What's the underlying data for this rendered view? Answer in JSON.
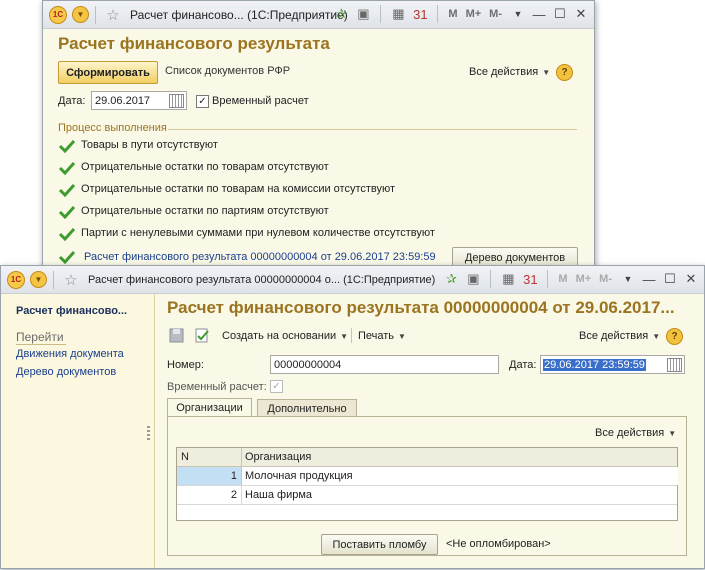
{
  "back_window": {
    "title": "Расчет финансово...  (1С:Предприятие)",
    "toolbar_m": [
      "M",
      "M+",
      "M-"
    ],
    "form_title": "Расчет финансового результата",
    "generate_button": "Сформировать",
    "docs_list_link": "Список документов РФР",
    "all_actions": "Все действия",
    "date_label": "Дата:",
    "date_value": "29.06.2017",
    "temp_calc_label": "Временный расчет",
    "process_group_label": "Процесс выполнения",
    "process_items": [
      "Товары в пути отсутствуют",
      "Отрицательные остатки по товарам отсутствуют",
      "Отрицательные остатки по товарам на комиссии отсутствуют",
      "Отрицательные остатки по партиям отсутствуют",
      "Партии с ненулевыми суммами при нулевом количестве отсутствуют",
      "Расчет финансового результата 00000000004 от 29.06.2017 23:59:59"
    ],
    "doc_tree_button": "Дерево документов"
  },
  "front_window": {
    "title": "Расчет финансового результата 00000000004 о...  (1С:Предприятие)",
    "toolbar_m": [
      "M",
      "M+",
      "M-"
    ],
    "sidebar": {
      "title": "Расчет финансово...",
      "section": "Перейти",
      "links": [
        "Движения документа",
        "Дерево документов"
      ]
    },
    "form_title": "Расчет финансового результата 00000000004 от 29.06.2017...",
    "toolbar": {
      "create_based_on": "Создать на основании",
      "print": "Печать",
      "all_actions": "Все действия"
    },
    "number_label": "Номер:",
    "number_value": "00000000004",
    "date_label": "Дата:",
    "date_value": "29.06.2017 23:59:59",
    "temp_calc_label": "Временный расчет:",
    "tabs": [
      "Организации",
      "Дополнительно"
    ],
    "table_all_actions": "Все действия",
    "table": {
      "headers": [
        "N",
        "Организация"
      ],
      "rows": [
        {
          "n": "1",
          "org": "Молочная продукция"
        },
        {
          "n": "2",
          "org": "Наша фирма"
        }
      ]
    },
    "seal_button": "Поставить пломбу",
    "seal_status": "<Не опломбирован>"
  },
  "colors": {
    "form_background": "#faf9e8",
    "title_accent": "#9b7420",
    "link": "#1b3f8f",
    "selected_row": "#c3dff3",
    "check_green": "#3d9b2f"
  }
}
